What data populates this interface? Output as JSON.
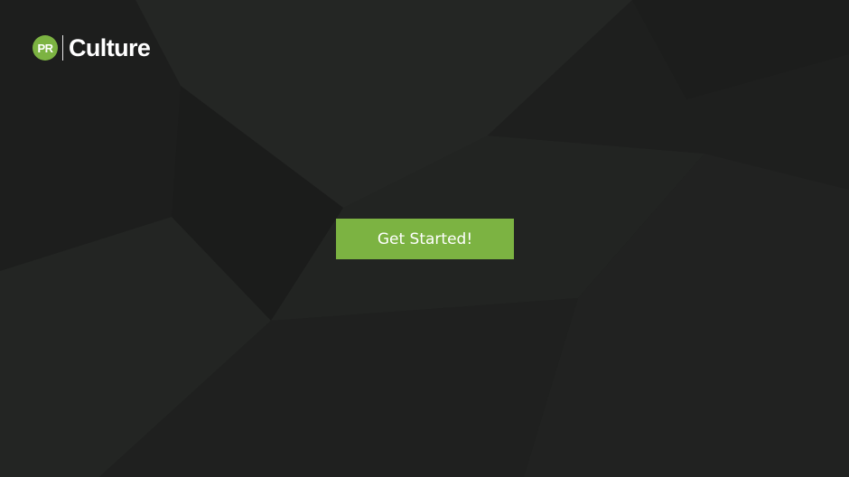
{
  "brand": {
    "badge_text": "PR",
    "wordmark": "Culture",
    "accent_color": "#7cb342"
  },
  "main": {
    "cta_label": "Get Started!"
  },
  "theme": {
    "background": "#202120"
  }
}
